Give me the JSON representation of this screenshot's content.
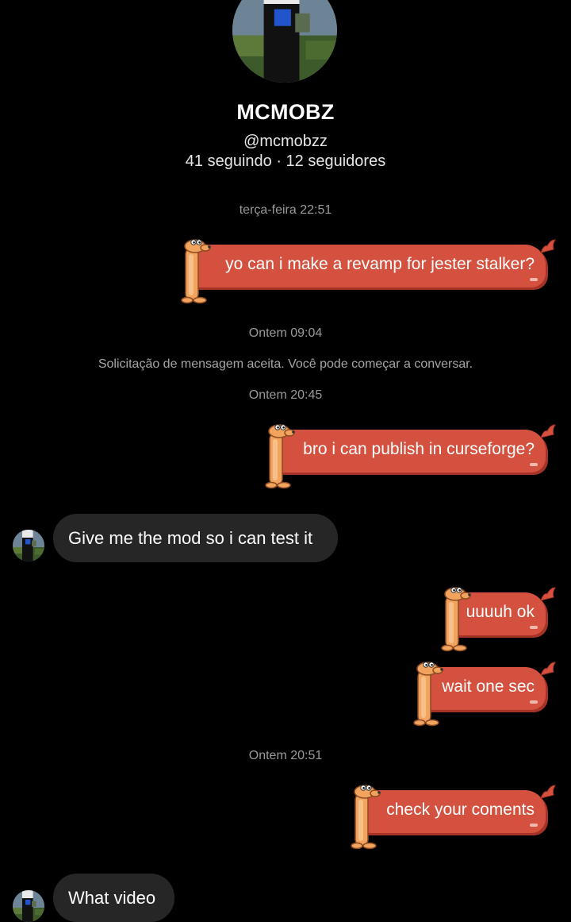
{
  "profile": {
    "name": "MCMOBZ",
    "handle": "@mcmobzz",
    "stats": "41 seguindo · 12 seguidores"
  },
  "thread": {
    "ts1": "terça-feira 22:51",
    "ts2": "Ontem 09:04",
    "system": "Solicitação de mensagem aceita. Você pode começar a conversar.",
    "ts3": "Ontem 20:45",
    "ts4": "Ontem 20:51"
  },
  "messages": {
    "m1": "yo can i make a revamp for jester stalker?",
    "m2": "bro i can publish in curseforge?",
    "m3": "Give me the mod so i can test it",
    "m4": "uuuuh ok",
    "m5": "wait one sec",
    "m6": "check your coments",
    "m7": "What video"
  },
  "colors": {
    "background": "#000000",
    "sent_bubble": "#d4513f",
    "received_bubble": "#262626",
    "dog": "#f2a35e"
  },
  "icons": {
    "sent_decoration": "dachshund-dog-icon"
  }
}
